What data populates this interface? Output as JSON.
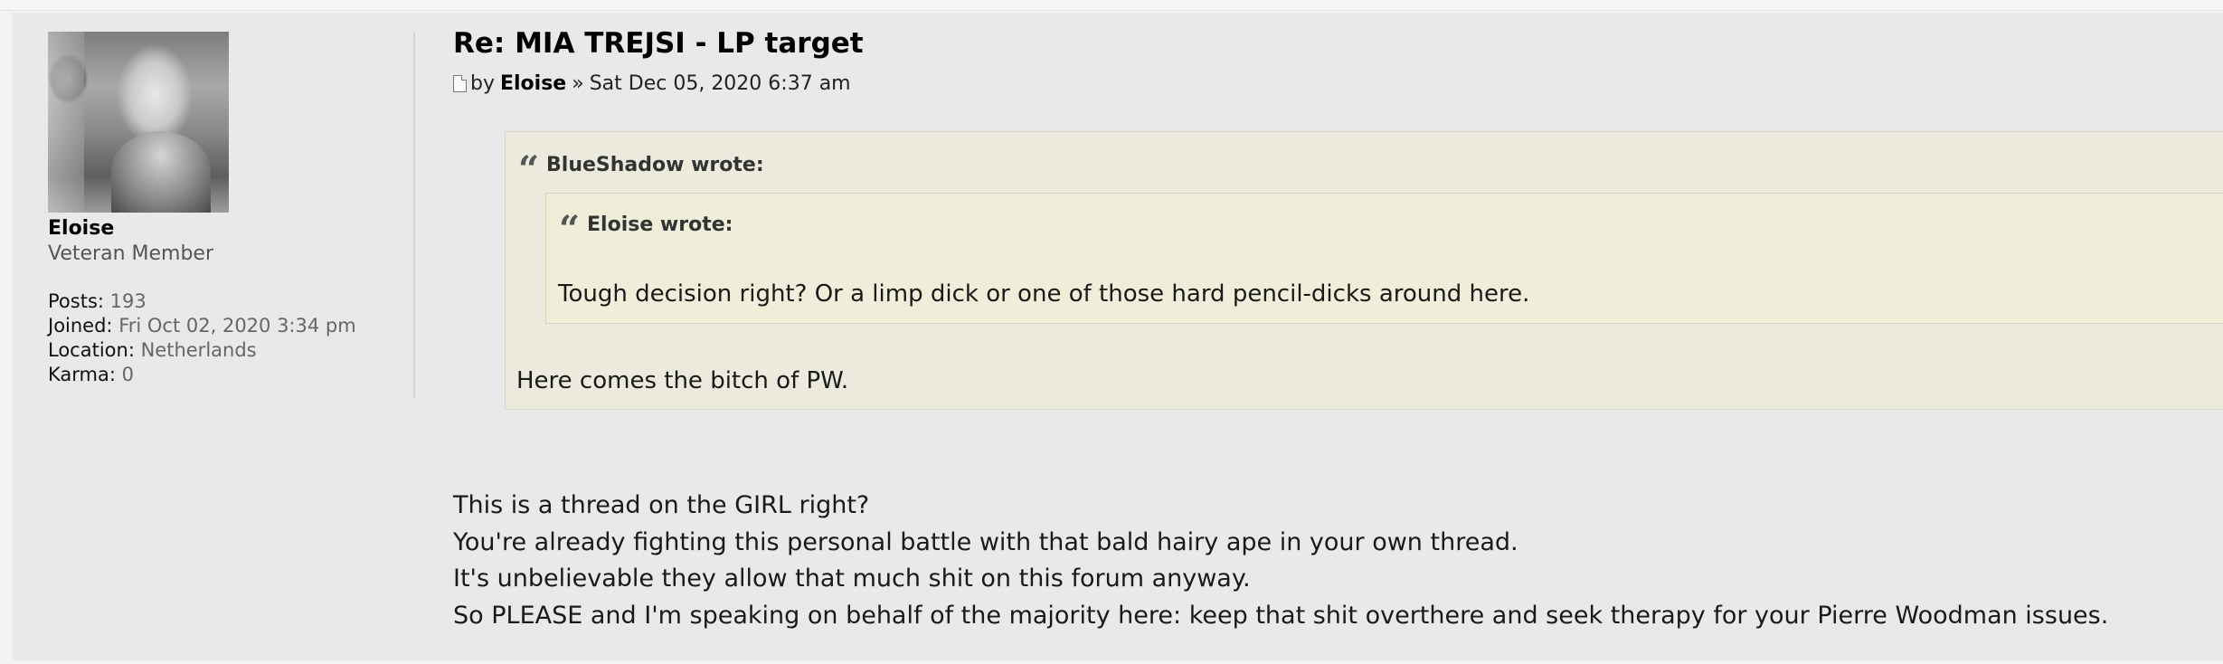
{
  "profile": {
    "username": "Eloise",
    "rank": "Veteran Member",
    "details": [
      {
        "label": "Posts:",
        "value": "193"
      },
      {
        "label": "Joined:",
        "value": "Fri Oct 02, 2020 3:34 pm"
      },
      {
        "label": "Location:",
        "value": "Netherlands"
      },
      {
        "label": "Karma:",
        "value": "0"
      }
    ]
  },
  "post": {
    "title": "Re: MIA TREJSI - LP target",
    "meta": {
      "by": "by",
      "author": "Eloise",
      "separator": "»",
      "date": "Sat Dec 05, 2020 6:37 am"
    },
    "quote": {
      "cite": "BlueShadow wrote:",
      "nested_quote": {
        "cite": "Eloise wrote:",
        "text": "Tough decision right? Or a limp dick or one of those hard pencil-dicks around here."
      },
      "text": "Here comes the bitch of PW."
    },
    "lines": [
      "This is a thread on the GIRL right?",
      "You're already fighting this personal battle with that bald hairy ape in your own thread.",
      "It's unbelievable they allow that much shit on this forum anyway.",
      "So PLEASE and I'm speaking on behalf of the majority here: keep that shit overthere and seek therapy for your Pierre Woodman issues."
    ]
  }
}
